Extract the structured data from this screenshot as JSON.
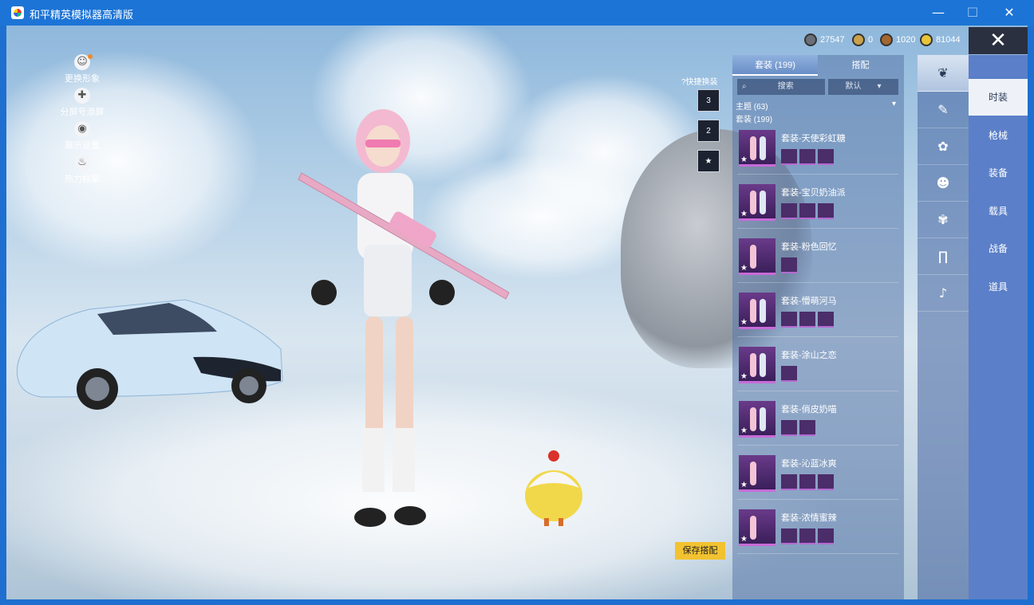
{
  "window": {
    "title": "和平精英模拟器高清版",
    "minimize": "—",
    "maximize": "☐",
    "close": "✕"
  },
  "left_menu": [
    {
      "label": "更换形象",
      "icon": "person-icon"
    },
    {
      "label": "分屏号添屏",
      "icon": "puzzle-icon"
    },
    {
      "label": "展示设置",
      "icon": "eye-icon"
    },
    {
      "label": "热力档案",
      "icon": "flame-icon"
    }
  ],
  "currencies": [
    {
      "value": "27547",
      "icon": "coin-dark-icon"
    },
    {
      "value": "0",
      "icon": "coin-gold-icon"
    },
    {
      "value": "1020",
      "icon": "coin-bronze-icon"
    },
    {
      "value": "81044",
      "icon": "coin-yellow-icon"
    }
  ],
  "close_label": "✕",
  "quick_swap": {
    "label": "?快捷换装",
    "slots": [
      "3",
      "2",
      "★"
    ]
  },
  "panel": {
    "tabs": [
      "套装 (199)",
      "搭配"
    ],
    "search_placeholder": "搜索",
    "sort_label": "默认",
    "theme_filter": "主题 (63)",
    "outfit_header": "套装 (199)",
    "outfits": [
      {
        "name": "套装-天使彩虹糖",
        "pieces": 3
      },
      {
        "name": "套装-宝贝奶油派",
        "pieces": 3
      },
      {
        "name": "套装-粉色回忆",
        "pieces": 1
      },
      {
        "name": "套装-懵萌河马",
        "pieces": 3
      },
      {
        "name": "套装-涂山之恋",
        "pieces": 1
      },
      {
        "name": "套装-俏皮奶喵",
        "pieces": 2
      },
      {
        "name": "套装-沁蓝冰爽",
        "pieces": 3
      },
      {
        "name": "套装-浓情蜜辣",
        "pieces": 3
      }
    ]
  },
  "save_button": "保存搭配",
  "icon_column": [
    "outfit-icon",
    "gun-icon",
    "helmet-skin-icon",
    "mask-icon",
    "top-icon",
    "pants-icon",
    "shoes-icon"
  ],
  "categories": [
    "时装",
    "枪械",
    "装备",
    "载具",
    "战备",
    "道具"
  ],
  "colors": {
    "titlebar": "#1c74d6",
    "save_button": "#f2c230",
    "category_column": "#5b7fc8"
  }
}
